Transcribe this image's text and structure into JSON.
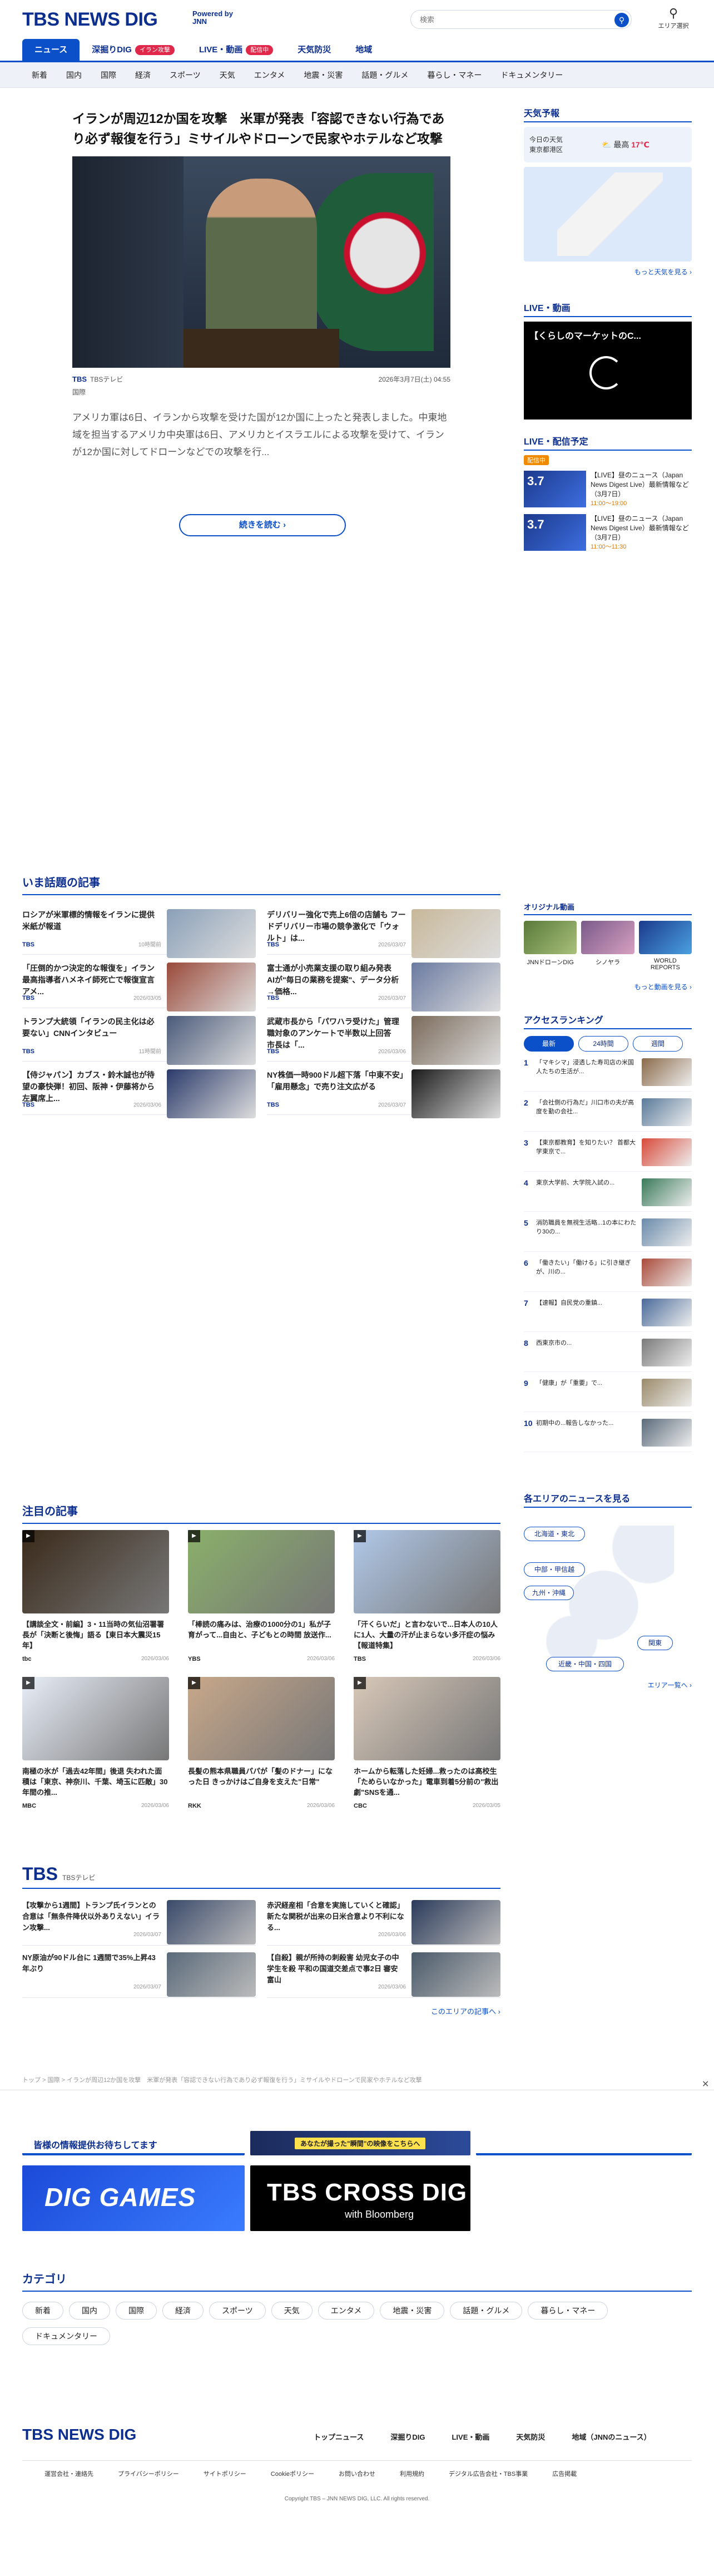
{
  "header": {
    "logo": "TBS NEWS DIG",
    "powered": "Powered by JNN",
    "search_placeholder": "検索",
    "area_label": "エリア選択"
  },
  "nav_primary": [
    {
      "label": "ニュース",
      "active": true
    },
    {
      "label": "深掘りDIG",
      "badge": "イラン攻撃"
    },
    {
      "label": "LIVE・動画",
      "badge": "配信中"
    },
    {
      "label": "天気防災"
    },
    {
      "label": "地域"
    }
  ],
  "nav_secondary": [
    "新着",
    "国内",
    "国際",
    "経済",
    "スポーツ",
    "天気",
    "エンタメ",
    "地震・災害",
    "話題・グルメ",
    "暮らし・マネー",
    "ドキュメンタリー"
  ],
  "main_article": {
    "title": "イランが周辺12か国を攻撃　米軍が発表「容認できない行為であり必ず報復を行う」ミサイルやドローンで民家やホテルなど攻撃",
    "source": "TBSテレビ",
    "date": "2026年3月7日(土) 04:55",
    "category": "国際",
    "lead": "アメリカ軍は6日、イランから攻撃を受けた国が12か国に上ったと発表しました。中東地域を担当するアメリカ中央軍は6日、アメリカとイスラエルによる攻撃を受けて、イランが12か国に対してドローンなどでの攻撃を行...",
    "read_more": "続きを読む"
  },
  "weather": {
    "heading": "天気予報",
    "today": "今日の天気",
    "city": "東京都港区",
    "high_label": "最高",
    "high": "17℃",
    "more": "もっと天気を見る"
  },
  "live": {
    "heading": "LIVE・動画",
    "video_title": "【くらしのマーケットのC..."
  },
  "live_schedule": {
    "heading": "LIVE・配信予定",
    "badge": "配信中",
    "items": [
      {
        "date": "3.7",
        "text": "【LIVE】昼のニュース（Japan News Digest Live）最新情報など（3月7日）",
        "time": "11:00〜19:00"
      },
      {
        "date": "3.7",
        "text": "【LIVE】昼のニュース（Japan News Digest Live）最新情報など（3月7日）",
        "time": "11:00〜11:30"
      }
    ]
  },
  "topics": {
    "heading": "いま話題の記事",
    "items": [
      {
        "title": "ロシアが米軍標的情報をイランに提供　米紙が報道",
        "source": "TBS",
        "date": "10時間前"
      },
      {
        "title": "デリバリー強化で売上6倍の店舗も フードデリバリー市場の競争激化で「ウォルト」は...",
        "source": "TBS",
        "date": "2026/03/07"
      },
      {
        "title": "「圧倒的かつ決定的な報復を」イラン最高指導者ハメネイ師死亡で報復宣言 アメ...",
        "source": "TBS",
        "date": "2026/03/05"
      },
      {
        "title": "富士通が小売業支援の取り組み発表　AIが\"毎日の業務を提案\"、データ分析→価格...",
        "source": "TBS",
        "date": "2026/03/07"
      },
      {
        "title": "トランプ大統領「イランの民主化は必要ない」CNNインタビュー",
        "source": "TBS",
        "date": "11時間前"
      },
      {
        "title": "武蔵市長から「パワハラ受けた」管理職対象のアンケートで半数以上回答　市長は「...",
        "source": "TBS",
        "date": "2026/03/06"
      },
      {
        "title": "【侍ジャパン】カブス・鈴木誠也が待望の豪快弾！初回、阪神・伊藤将から左翼席上...",
        "source": "TBS",
        "date": "2026/03/06"
      },
      {
        "title": "NY株価一時900ドル超下落「中東不安」「雇用懸念」で売り注文広がる",
        "source": "TBS",
        "date": "2026/03/07"
      }
    ]
  },
  "original": {
    "heading": "オリジナル動画",
    "items": [
      "JNNドローンDIG",
      "シノヤラ",
      "WORLD REPORTS"
    ],
    "more": "もっと動画を見る"
  },
  "ranking": {
    "heading": "アクセスランキング",
    "tabs": [
      "最新",
      "24時間",
      "週間"
    ],
    "items": [
      "「マキシマ」浸透した寿司店の米国人たちの生活が...",
      "「会社側の行為だ」川口市の夫が高度を勤の会社...",
      "【東京都教育】を知りたい？ 首都大学東京で...",
      "東京大学前、大学院入試の...",
      "消防職員を無視生活略...1の本にわたり30の...",
      "「働きたい」「働ける」に引き継ぎが、川の...",
      "【速報】自民党の重鎮...",
      "西東京市の...",
      "「健康」が「重要」で...",
      "初期中の...報告しなかった..."
    ]
  },
  "featured": {
    "heading": "注目の記事",
    "items": [
      {
        "title": "【講談全文・前編】3・11当時の気仙沼署署長が「決断と後悔」語る【東日本大震災15年】",
        "source": "tbc",
        "date": "2026/03/06"
      },
      {
        "title": "「棒読の痛みは、治療の1000分の1」私が子育がって...自由と、子どもとの時間 放送作...",
        "source": "YBS",
        "date": "2026/03/06"
      },
      {
        "title": "「汗くらいだ」と言わないで...日本人の10人に1人、大量の汗が止まらない多汗症の悩み【報道特集】",
        "source": "TBS",
        "date": "2026/03/06"
      },
      {
        "title": "南極の氷が「過去42年間」後退 失われた面積は「東京、神奈川、千葉、埼玉に匹敵」30年間の推...",
        "source": "MBC",
        "date": "2026/03/06"
      },
      {
        "title": "長髪の熊本県職員パパが「髪のドナー」になった日 きっかけはご自身を支えた\"日常\"",
        "source": "RKK",
        "date": "2026/03/06"
      },
      {
        "title": "ホームから転落した妊婦...救ったのは高校生「ためらいなかった」電車到着5分前の\"救出劇\"SNSを通...",
        "source": "CBC",
        "date": "2026/03/05"
      }
    ]
  },
  "regions": {
    "heading": "各エリアのニュースを見る",
    "buttons": [
      "北海道・東北",
      "中部・甲信越",
      "九州・沖縄",
      "関東",
      "近畿・中国・四国"
    ],
    "more": "エリア一覧へ"
  },
  "tbs_block": {
    "logo": "TBS",
    "sub": "TBSテレビ",
    "items": [
      {
        "title": "【攻撃から1週間】トランプ氏イランとの合意は「無条件降伏以外ありえない」イラン攻撃...",
        "date": "2026/03/07"
      },
      {
        "title": "赤沢経産相「合意を実施していくと確認」新たな関税が出来の日米合意より不利になる...",
        "date": "2026/03/06"
      },
      {
        "title": "NY原油が90ドル台に 1週間で35%上昇43年ぶり",
        "date": "2026/03/07"
      },
      {
        "title": "【自殺】親が所持の刺殺害 幼児女子の中学生を殺 平和の国道交差点で事2日 審安 富山",
        "date": "2026/03/06"
      }
    ],
    "more": "このエリアの記事へ"
  },
  "breadcrumb": "トップ > 国際 > イランが周辺12か国を攻撃　米軍が発表「容認できない行為であり必ず報復を行う」ミサイルやドローンで民家やホテルなど攻撃",
  "ads": {
    "banner1": "皆様の情報提供お待ちしてます",
    "banner2": "あなたが撮った\"瞬間\"の映像をこちらへ",
    "dig_games": "DIG GAMES",
    "cross_dig": "TBS CROSS DIG",
    "cross_dig_sub": "with Bloomberg"
  },
  "categories": {
    "heading": "カテゴリ",
    "items": [
      "新着",
      "国内",
      "国際",
      "経済",
      "スポーツ",
      "天気",
      "エンタメ",
      "地震・災害",
      "話題・グルメ",
      "暮らし・マネー",
      "ドキュメンタリー"
    ]
  },
  "footer": {
    "logo": "TBS NEWS DIG",
    "nav": [
      "トップニュース",
      "深掘りDIG",
      "LIVE・動画",
      "天気防災",
      "地域（JNNのニュース）"
    ],
    "links": [
      "運営会社・連絡先",
      "プライバシーポリシー",
      "サイトポリシー",
      "Cookieポリシー",
      "お問い合わせ",
      "利用規約",
      "デジタル広告会社・TBS事業",
      "広告掲載"
    ],
    "copyright": "Copyright TBS – JNN NEWS DIG, LLC. All rights reserved."
  }
}
